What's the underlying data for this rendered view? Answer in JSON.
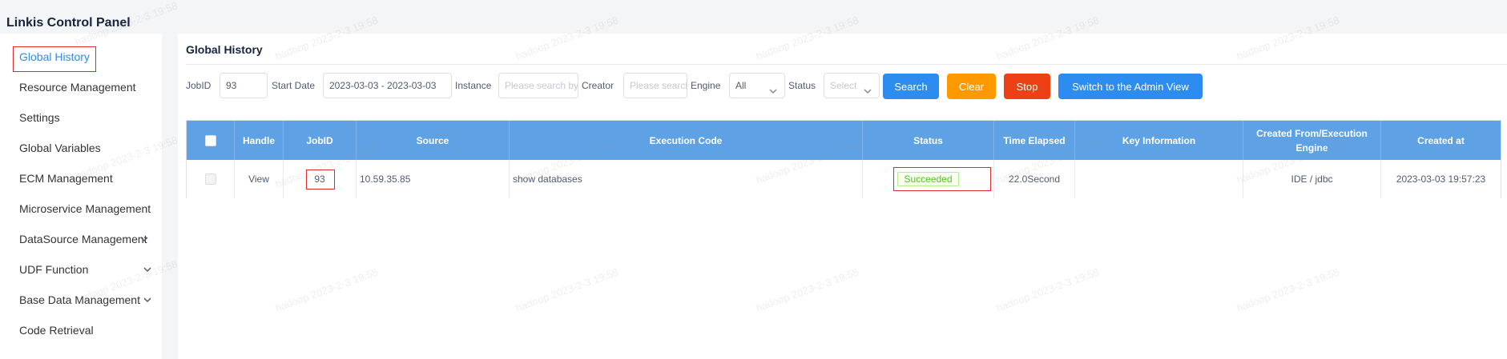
{
  "app": {
    "title": "Linkis Control Panel"
  },
  "sidebar": {
    "items": [
      {
        "label": "Global History",
        "active": true,
        "expandable": false
      },
      {
        "label": "Resource Management",
        "active": false,
        "expandable": false
      },
      {
        "label": "Settings",
        "active": false,
        "expandable": false
      },
      {
        "label": "Global Variables",
        "active": false,
        "expandable": false
      },
      {
        "label": "ECM Management",
        "active": false,
        "expandable": false
      },
      {
        "label": "Microservice Management",
        "active": false,
        "expandable": false
      },
      {
        "label": "DataSource Management",
        "active": false,
        "expandable": true
      },
      {
        "label": "UDF Function",
        "active": false,
        "expandable": true
      },
      {
        "label": "Base Data Management",
        "active": false,
        "expandable": true
      },
      {
        "label": "Code Retrieval",
        "active": false,
        "expandable": false
      }
    ]
  },
  "main": {
    "title": "Global History",
    "filters": {
      "jobid_label": "JobID",
      "jobid_value": "93",
      "start_date_label": "Start Date",
      "start_date_value": "2023-03-03 - 2023-03-03",
      "instance_label": "Instance",
      "instance_placeholder": "Please search by",
      "creator_label": "Creator",
      "creator_placeholder": "Please search",
      "engine_label": "Engine",
      "engine_value": "All",
      "status_label": "Status",
      "status_placeholder": "Select",
      "search_btn": "Search",
      "clear_btn": "Clear",
      "stop_btn": "Stop",
      "admin_btn": "Switch to the Admin View"
    },
    "table": {
      "headers": {
        "handle": "Handle",
        "jobid": "JobID",
        "source": "Source",
        "code": "Execution Code",
        "status": "Status",
        "elapsed": "Time Elapsed",
        "key_info": "Key Information",
        "created_from": "Created From/Execution Engine",
        "created_at": "Created at"
      },
      "rows": [
        {
          "handle": "View",
          "jobid": "93",
          "source": "10.59.35.85",
          "code": "show databases",
          "status": "Succeeded",
          "elapsed": "22.0Second",
          "key_info": "",
          "created_from": "IDE / jdbc",
          "created_at": "2023-03-03 19:57:23"
        }
      ]
    }
  },
  "watermark": "hadoop 2023-2-3 19:58",
  "colors": {
    "accent": "#2d8cf0",
    "header_blue": "#5ea2e5",
    "orange": "#ff9900",
    "red": "#ed4014",
    "success": "#52c41a",
    "highlight": "#e0282e"
  }
}
